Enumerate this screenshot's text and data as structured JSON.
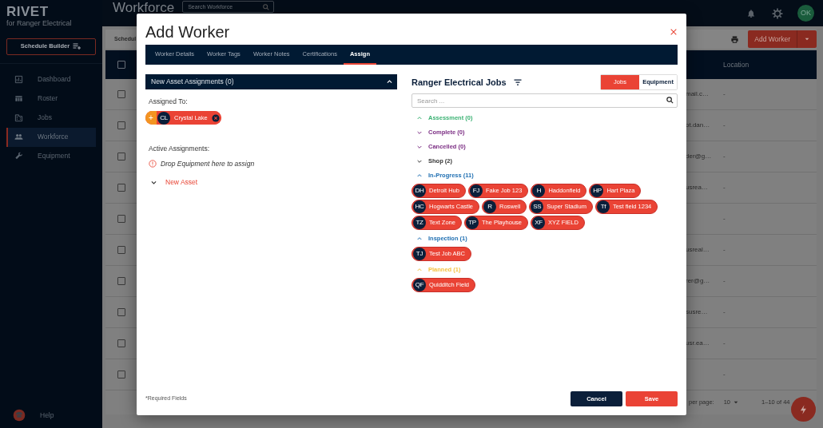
{
  "sidebar": {
    "logo": "RIVET",
    "subtitle": "for Ranger Electrical",
    "schedule_button": "Schedule Builder",
    "items": [
      {
        "label": "Dashboard",
        "selected": false
      },
      {
        "label": "Roster",
        "selected": false
      },
      {
        "label": "Jobs",
        "selected": false
      },
      {
        "label": "Workforce",
        "selected": true
      },
      {
        "label": "Equipment",
        "selected": false
      }
    ],
    "help": "Help"
  },
  "header": {
    "title": "Workforce",
    "search": {
      "placeholder": "Search Workforce"
    },
    "avatar": "OK"
  },
  "toolbar": {
    "tab": "Schedul",
    "add_button": "Add Worker"
  },
  "table": {
    "select_all_checked": false,
    "columns": [
      "Location"
    ],
    "rows": [
      {
        "checked": false,
        "email": "mail.c…",
        "location": "-"
      },
      {
        "checked": false,
        "email": "ot.dan…",
        "location": "-"
      },
      {
        "checked": false,
        "email": "der@g…",
        "location": "-"
      },
      {
        "checked": false,
        "email": "usrea…",
        "location": "-"
      },
      {
        "checked": false,
        "location": "-"
      },
      {
        "checked": false,
        "email": "usreal…",
        "location": "-"
      },
      {
        "checked": false,
        "email": "rer@g…",
        "location": "-"
      },
      {
        "checked": false,
        "email": "susre…",
        "location": "-"
      },
      {
        "checked": false,
        "email": "usr.ea…",
        "location": "-"
      },
      {
        "checked": false,
        "location": "-"
      }
    ]
  },
  "pagination": {
    "rows_label": "per page:",
    "per_page": "10",
    "range": "1–10 of 44"
  },
  "modal": {
    "title": "Add Worker",
    "tabs": [
      {
        "label": "Worker Details",
        "selected": false
      },
      {
        "label": "Worker Tags",
        "selected": false
      },
      {
        "label": "Worker Notes",
        "selected": false
      },
      {
        "label": "Certifications",
        "selected": false
      },
      {
        "label": "Assign",
        "selected": true
      }
    ],
    "assignments": {
      "header": "New Asset Assignments (0)",
      "expanded": true,
      "assigned_label": "Assigned To:",
      "assignee": {
        "add": "+",
        "initials": "CL",
        "name": "Crystal Lake"
      },
      "active_label": "Active Assignments:",
      "drop_hint": "Drop Equipment here to assign",
      "new_asset": "New Asset"
    },
    "jobs": {
      "title": "Ranger Electrical Jobs",
      "toggle": [
        {
          "label": "Jobs",
          "selected": true
        },
        {
          "label": "Equipment",
          "selected": false
        }
      ],
      "search": {
        "placeholder": "Search ..."
      },
      "groups": [
        {
          "label": "Assessment (0)",
          "color": "#3bb273",
          "expanded": true
        },
        {
          "label": "Complete (0)",
          "color": "#7b2d83",
          "expanded": false
        },
        {
          "label": "Cancelled (0)",
          "color": "#7b2d83",
          "expanded": false
        },
        {
          "label": "Shop (2)",
          "color": "#333333",
          "expanded": false
        },
        {
          "label": "In-Progress (11)",
          "color": "#1f6fb2",
          "expanded": true,
          "jobs": [
            {
              "initials": "DH",
              "name": "Detroit Hub"
            },
            {
              "initials": "FJ",
              "name": "Fake Job 123"
            },
            {
              "initials": "H",
              "name": "Haddonfield"
            },
            {
              "initials": "HP",
              "name": "Hart Plaza"
            },
            {
              "initials": "HC",
              "name": "Hogwarts Castle"
            },
            {
              "initials": "R",
              "name": "Roswell"
            },
            {
              "initials": "SS",
              "name": "Super Stadium"
            },
            {
              "initials": "Tf",
              "name": "Test field 1234"
            },
            {
              "initials": "TZ",
              "name": "Text Zone"
            },
            {
              "initials": "TP",
              "name": "The Playhouse"
            },
            {
              "initials": "XF",
              "name": "XYZ FIELD"
            }
          ]
        },
        {
          "label": "Inspection (1)",
          "color": "#1f6fb2",
          "expanded": true,
          "jobs": [
            {
              "initials": "TJ",
              "name": "Test Job ABC"
            }
          ]
        },
        {
          "label": "Planned (1)",
          "color": "#f5c242",
          "expanded": true,
          "jobs": [
            {
              "initials": "QF",
              "name": "Quidditch Field"
            }
          ]
        }
      ]
    },
    "footer_note": "*Required Fields",
    "buttons": [
      {
        "label": "Cancel",
        "kind": "secondary"
      },
      {
        "label": "Save",
        "kind": "primary"
      }
    ]
  }
}
